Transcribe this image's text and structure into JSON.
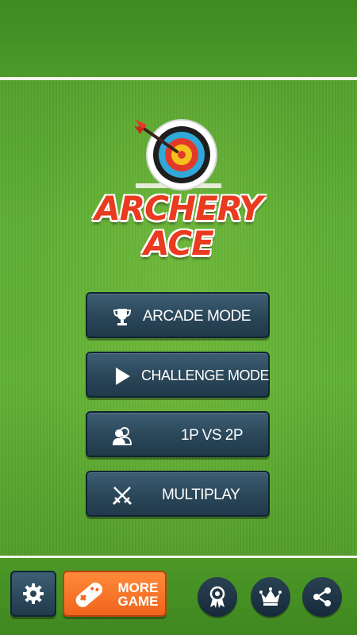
{
  "game": {
    "title_line1": "ARCHERY",
    "title_line2": "ACE"
  },
  "menu": {
    "arcade": "ARCADE MODE",
    "challenge": "CHALLENGE MODE",
    "versus": "1P VS 2P",
    "multiplay": "MULTIPLAY"
  },
  "bottom_bar": {
    "more_line1": "MORE",
    "more_line2": "GAME"
  },
  "icons": {
    "arcade": "trophy-icon",
    "challenge": "play-icon",
    "versus": "two-players-icon",
    "multiplay": "crossed-swords-icon",
    "settings": "gear-icon",
    "more": "gamepad-icon",
    "achievements": "medal-icon",
    "leaderboard": "crown-icon",
    "share": "share-icon"
  },
  "colors": {
    "grass": "#5fae35",
    "button": "#2a4658",
    "title_red": "#ea3a1f",
    "more_orange": "#f0641c"
  }
}
